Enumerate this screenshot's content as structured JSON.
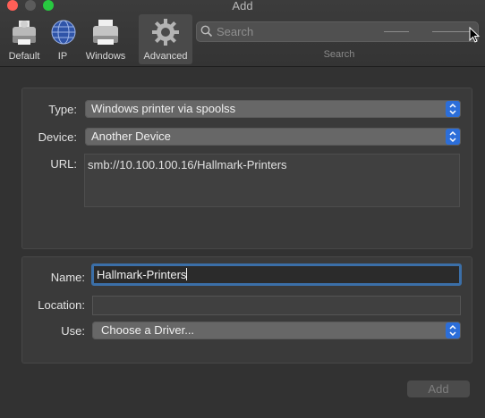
{
  "window": {
    "title": "Add"
  },
  "toolbar": {
    "items": [
      {
        "label": "Default",
        "icon": "default-printer-icon"
      },
      {
        "label": "IP",
        "icon": "globe-icon"
      },
      {
        "label": "Windows",
        "icon": "windows-printer-icon"
      },
      {
        "label": "Advanced",
        "icon": "gear-icon",
        "selected": true
      }
    ],
    "search": {
      "placeholder": "Search",
      "caption": "Search"
    }
  },
  "connection": {
    "type_label": "Type:",
    "type_value": "Windows printer via spoolss",
    "device_label": "Device:",
    "device_value": "Another Device",
    "url_label": "URL:",
    "url_value": "smb://10.100.100.16/Hallmark-Printers"
  },
  "printer": {
    "name_label": "Name:",
    "name_value": "Hallmark-Printers",
    "location_label": "Location:",
    "location_value": "",
    "use_label": "Use:",
    "use_value": "Choose a Driver..."
  },
  "footer": {
    "add_label": "Add"
  },
  "colors": {
    "accent": "#2c6ed9",
    "focus_ring": "#3b6fa8",
    "window_bg": "#323232"
  }
}
